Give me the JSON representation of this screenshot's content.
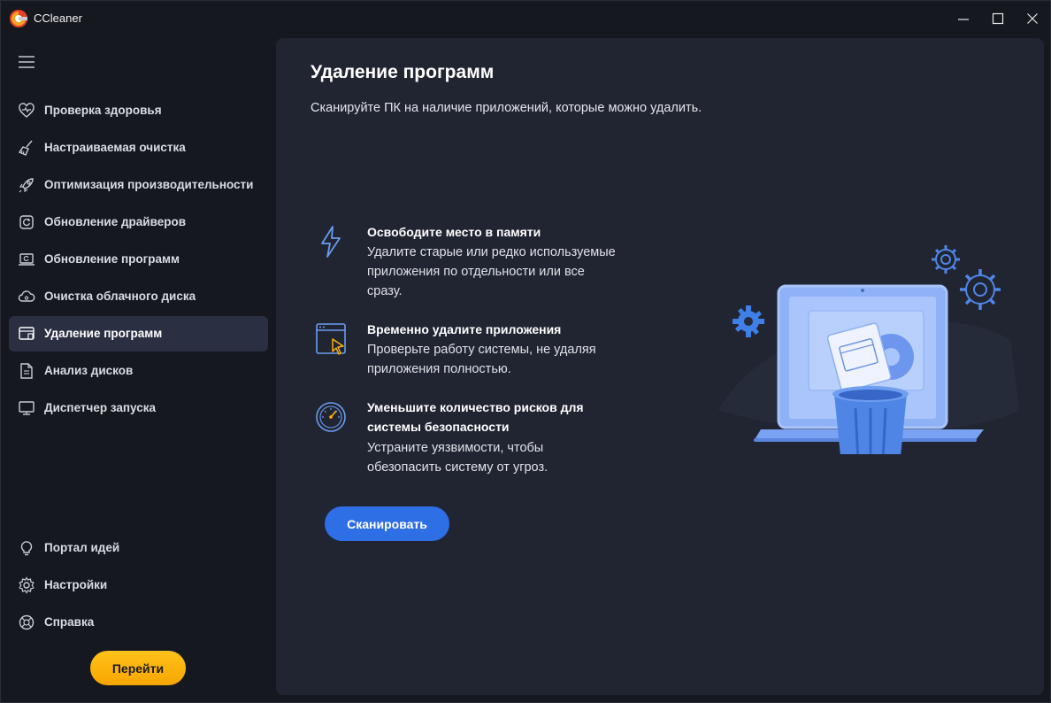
{
  "window": {
    "title": "CCleaner",
    "controls": [
      "minimize-icon",
      "maximize-icon",
      "close-icon"
    ]
  },
  "sidebar": {
    "menu_icon": "hamburger-icon",
    "items": [
      {
        "label": "Проверка здоровья",
        "icon": "heart-icon"
      },
      {
        "label": "Настраиваемая очистка",
        "icon": "broom-icon"
      },
      {
        "label": "Оптимизация производительности",
        "icon": "rocket-icon"
      },
      {
        "label": "Обновление драйверов",
        "icon": "chip-icon"
      },
      {
        "label": "Обновление программ",
        "icon": "laptop-update-icon"
      },
      {
        "label": "Очистка облачного диска",
        "icon": "cloud-gear-icon"
      },
      {
        "label": "Удаление программ",
        "icon": "uninstall-icon",
        "active": true
      },
      {
        "label": "Анализ дисков",
        "icon": "document-icon"
      },
      {
        "label": "Диспетчер запуска",
        "icon": "monitor-icon"
      }
    ],
    "bottom_items": [
      {
        "label": "Портал идей",
        "icon": "lightbulb-icon"
      },
      {
        "label": "Настройки",
        "icon": "gear-icon"
      },
      {
        "label": "Справка",
        "icon": "help-icon"
      }
    ],
    "go_button": "Перейти"
  },
  "main": {
    "title": "Удаление программ",
    "subtitle": "Сканируйте ПК на наличие приложений, которые можно удалить.",
    "features": [
      {
        "icon": "lightning-icon",
        "title": "Освободите место в памяти",
        "desc_lines": [
          "Удалите старые или редко используемые",
          "приложения по отдельности или все",
          "сразу."
        ]
      },
      {
        "icon": "window-cursor-icon",
        "title": "Временно удалите приложения",
        "desc_lines": [
          "Проверьте работу системы, не удаляя",
          "приложения полностью."
        ]
      },
      {
        "icon": "speedometer-icon",
        "title_lines": [
          "Уменьшите количество рисков для",
          "системы безопасности"
        ],
        "desc_lines": [
          "Устраните уязвимости, чтобы",
          "обезопасить систему от угроз."
        ]
      }
    ],
    "scan_button": "Сканировать"
  },
  "colors": {
    "background": "#16181f",
    "panel": "#212532",
    "active_item": "#2a3042",
    "accent_blue": "#2f6fe6",
    "accent_yellow": "#ffb80a",
    "icon_blue": "#6a9cf0"
  }
}
